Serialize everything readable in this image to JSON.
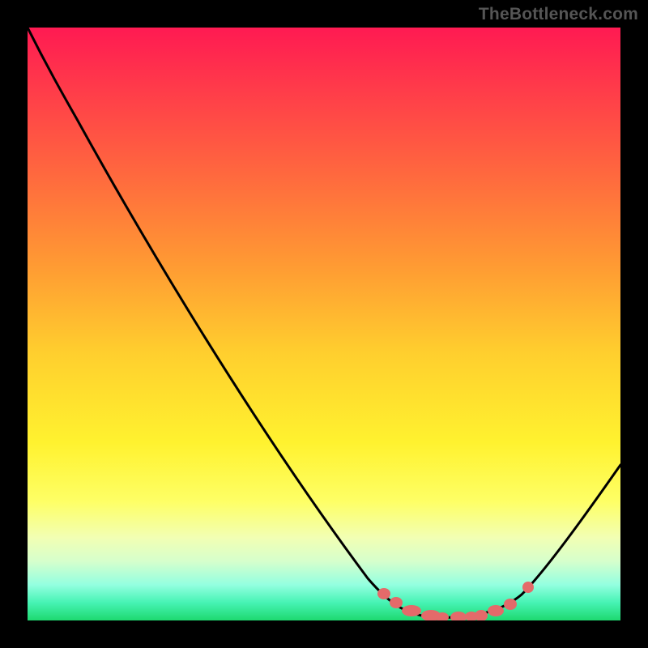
{
  "watermark": "TheBottleneck.com",
  "colors": {
    "background": "#000000",
    "gradient_top": "#ff1a52",
    "gradient_bottom": "#1ed96f",
    "curve": "#000000",
    "datapoints": "#e46a6a",
    "watermark_text": "#555555"
  },
  "chart_data": {
    "type": "line",
    "title": "",
    "xlabel": "",
    "ylabel": "",
    "xlim": [
      0,
      100
    ],
    "ylim": [
      0,
      100
    ],
    "grid": false,
    "legend": false,
    "x": [
      0,
      8,
      16,
      36,
      57,
      63,
      68,
      75,
      82,
      88,
      94,
      100
    ],
    "values": [
      100,
      84,
      70,
      37,
      8,
      3,
      1,
      0,
      1,
      4,
      15,
      26
    ],
    "series": [
      {
        "name": "bottleneck-curve",
        "x": [
          0,
          8,
          16,
          36,
          57,
          63,
          68,
          75,
          82,
          88,
          94,
          100
        ],
        "values": [
          100,
          84,
          70,
          37,
          8,
          3,
          1,
          0,
          1,
          4,
          15,
          26
        ]
      },
      {
        "name": "highlighted-points",
        "x": [
          60,
          62,
          65,
          68,
          70,
          73,
          75,
          77,
          79,
          81,
          84
        ],
        "values": [
          4.5,
          3.0,
          1.6,
          0.8,
          0.5,
          0.5,
          0.6,
          0.8,
          1.6,
          2.7,
          5.6
        ]
      }
    ],
    "background_gradient": {
      "orientation": "vertical",
      "stops": [
        {
          "pos": 0.0,
          "color": "#ff1a52"
        },
        {
          "pos": 0.1,
          "color": "#ff3a4a"
        },
        {
          "pos": 0.25,
          "color": "#ff693e"
        },
        {
          "pos": 0.4,
          "color": "#ff9a33"
        },
        {
          "pos": 0.55,
          "color": "#ffcf2e"
        },
        {
          "pos": 0.7,
          "color": "#fff22f"
        },
        {
          "pos": 0.8,
          "color": "#feff66"
        },
        {
          "pos": 0.86,
          "color": "#f2ffb3"
        },
        {
          "pos": 0.9,
          "color": "#d6ffcc"
        },
        {
          "pos": 0.94,
          "color": "#93ffe0"
        },
        {
          "pos": 0.97,
          "color": "#46f3b4"
        },
        {
          "pos": 1.0,
          "color": "#1ed96f"
        }
      ]
    }
  }
}
